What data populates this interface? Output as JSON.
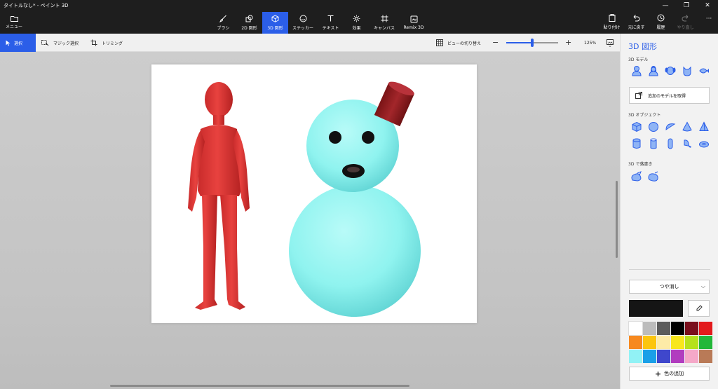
{
  "window": {
    "title": "タイトルなし* - ペイント 3D",
    "controls": [
      "—",
      "❐",
      "✕"
    ]
  },
  "menu": {
    "label": "メニュー"
  },
  "tools": [
    {
      "id": "brush",
      "label": "ブラシ"
    },
    {
      "id": "2dshapes",
      "label": "2D 図形"
    },
    {
      "id": "3dshapes",
      "label": "3D 図形",
      "active": true
    },
    {
      "id": "stickers",
      "label": "ステッカー"
    },
    {
      "id": "text",
      "label": "テキスト"
    },
    {
      "id": "effects",
      "label": "効果"
    },
    {
      "id": "canvas",
      "label": "キャンバス"
    },
    {
      "id": "remix",
      "label": "Remix 3D"
    }
  ],
  "right_tools": [
    {
      "id": "paste",
      "label": "貼り付け"
    },
    {
      "id": "undo",
      "label": "元に戻す"
    },
    {
      "id": "history",
      "label": "履歴"
    },
    {
      "id": "redo",
      "label": "やり直し",
      "disabled": true
    }
  ],
  "more_label": "···",
  "subtoolbar": {
    "select": "選択",
    "magic_select": "マジック選択",
    "crop": "トリミング",
    "view_toggle": "ビューの切り替え",
    "zoom_level": "125%",
    "zoom_fraction": 0.5
  },
  "panel": {
    "title": "3D 図形",
    "models_label": "3D モデル",
    "get_models": "追加のモデルを取得",
    "objects_label": "3D オブジェクト",
    "doodle_label": "3D で落書き",
    "finish": "つや消し",
    "current_color": "#151515",
    "palette": [
      "#ffffff",
      "#bcbcbc",
      "#5c5c5c",
      "#000000",
      "#7a0f1c",
      "#e31a1c",
      "#f7891f",
      "#fcc50e",
      "#fdeba7",
      "#f8e71c",
      "#b6e11c",
      "#22b73a",
      "#91f2f5",
      "#1aa0e8",
      "#3f47cc",
      "#b13cbf",
      "#f5a8c8",
      "#b97a57"
    ],
    "add_color": "色の追加"
  },
  "scene": {
    "person_color": "#e8423f",
    "snowman_color": "#8ff3ef",
    "hat_color": "#a3262a"
  }
}
